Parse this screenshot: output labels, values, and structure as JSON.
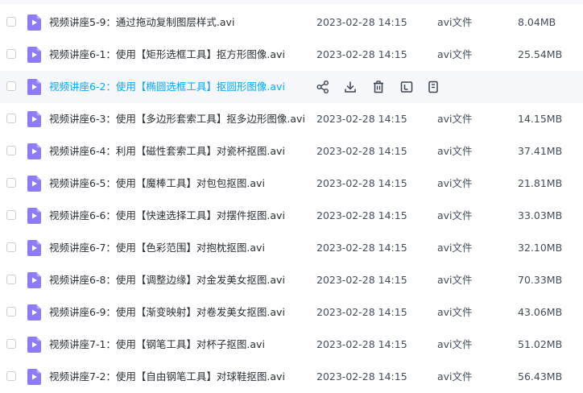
{
  "files": [
    {
      "name": "视频讲座5-9：通过拖动复制图层样式.avi",
      "date": "2023-02-28 14:15",
      "type": "avi文件",
      "size": "8.04MB"
    },
    {
      "name": "视频讲座6-1：使用【矩形选框工具】抠方形图像.avi",
      "date": "2023-02-28 14:15",
      "type": "avi文件",
      "size": "25.54MB"
    },
    {
      "name": "视频讲座6-2：使用【椭圆选框工具】抠圆形图像.avi",
      "date": "",
      "type": "",
      "size": "",
      "hovered": true
    },
    {
      "name": "视频讲座6-3：使用【多边形套索工具】抠多边形图像.avi",
      "date": "2023-02-28 14:15",
      "type": "avi文件",
      "size": "14.15MB"
    },
    {
      "name": "视频讲座6-4：利用【磁性套索工具】对瓷杯抠图.avi",
      "date": "2023-02-28 14:15",
      "type": "avi文件",
      "size": "37.41MB"
    },
    {
      "name": "视频讲座6-5：使用【魔棒工具】对包包抠图.avi",
      "date": "2023-02-28 14:15",
      "type": "avi文件",
      "size": "21.81MB"
    },
    {
      "name": "视频讲座6-6：使用【快速选择工具】对摆件抠图.avi",
      "date": "2023-02-28 14:15",
      "type": "avi文件",
      "size": "33.03MB"
    },
    {
      "name": "视频讲座6-7：使用【色彩范围】对抱枕抠图.avi",
      "date": "2023-02-28 14:15",
      "type": "avi文件",
      "size": "32.10MB"
    },
    {
      "name": "视频讲座6-8：使用【调整边缘】对金发美女抠图.avi",
      "date": "2023-02-28 14:15",
      "type": "avi文件",
      "size": "70.33MB"
    },
    {
      "name": "视频讲座6-9：使用【渐变映射】对卷发美女抠图.avi",
      "date": "2023-02-28 14:15",
      "type": "avi文件",
      "size": "43.06MB"
    },
    {
      "name": "视频讲座7-1：使用【钢笔工具】对杯子抠图.avi",
      "date": "2023-02-28 14:15",
      "type": "avi文件",
      "size": "51.02MB"
    },
    {
      "name": "视频讲座7-2：使用【自由钢笔工具】对球鞋抠图.avi",
      "date": "2023-02-28 14:15",
      "type": "avi文件",
      "size": "56.43MB"
    }
  ],
  "row_actions": [
    {
      "icon": "share-icon",
      "name": "share-button"
    },
    {
      "icon": "download-icon",
      "name": "download-button"
    },
    {
      "icon": "trash-icon",
      "name": "delete-button"
    },
    {
      "icon": "rename-icon",
      "name": "rename-button"
    },
    {
      "icon": "more-icon",
      "name": "more-button"
    }
  ],
  "colors": {
    "accent": "#06a7ff",
    "video_icon": "#8f7bf7",
    "text": "#2b2f36",
    "secondary_text": "#454d5a",
    "hover_bg": "#f5f7fa"
  }
}
